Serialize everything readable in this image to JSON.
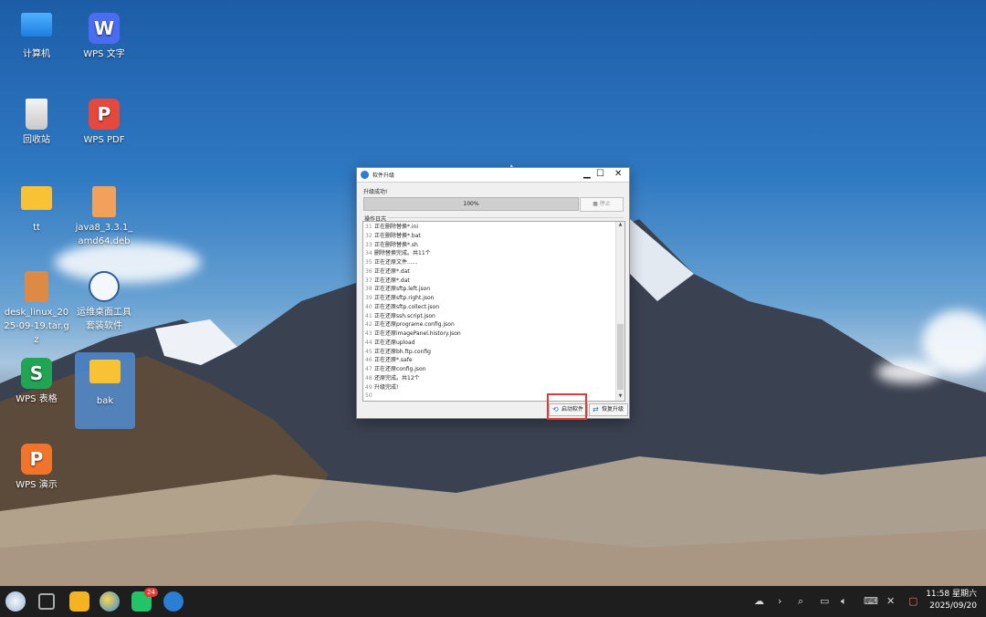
{
  "desktop_icons": [
    {
      "label": "计算机",
      "icon": "computer-icon"
    },
    {
      "label": "WPS 文字",
      "icon": "wps-writer-icon"
    },
    {
      "label": "回收站",
      "icon": "recycle-bin-icon"
    },
    {
      "label": "WPS PDF",
      "icon": "wps-pdf-icon"
    },
    {
      "label": "tt",
      "icon": "folder-icon"
    },
    {
      "label": "java8_3.3.1_amd64.deb",
      "icon": "deb-package-icon"
    },
    {
      "label": "desk_linux_2025-09-19.tar.gz",
      "icon": "archive-icon"
    },
    {
      "label": "运维桌面工具套装软件",
      "icon": "ops-tool-icon"
    },
    {
      "label": "WPS 表格",
      "icon": "wps-sheets-icon"
    },
    {
      "label": "bak",
      "icon": "folder-icon"
    },
    {
      "label": "WPS 演示",
      "icon": "wps-presentation-icon"
    }
  ],
  "dialog": {
    "title": "软件升级",
    "status": "升级成功!",
    "progress_text": "100%",
    "progress_value": 100,
    "stop_label": "停止",
    "log_group_label": "操作日志",
    "log": [
      {
        "n": "31",
        "text": "正在删除替换*.ini"
      },
      {
        "n": "32",
        "text": "正在删除替换*.bat"
      },
      {
        "n": "33",
        "text": "正在删除替换*.sh"
      },
      {
        "n": "34",
        "text": "删除替换完成。共11个"
      },
      {
        "n": "35",
        "text": "正在还原文件......"
      },
      {
        "n": "36",
        "text": "正在还原*.dat"
      },
      {
        "n": "37",
        "text": "正在还原*.dat"
      },
      {
        "n": "38",
        "text": "正在还原sftp.left.json"
      },
      {
        "n": "39",
        "text": "正在还原sftp.right.json"
      },
      {
        "n": "40",
        "text": "正在还原sftp.collect.json"
      },
      {
        "n": "41",
        "text": "正在还原ssh.script.json"
      },
      {
        "n": "42",
        "text": "正在还原programe.config.json"
      },
      {
        "n": "43",
        "text": "正在还原imagePanel.history.json"
      },
      {
        "n": "44",
        "text": "正在还原upload"
      },
      {
        "n": "45",
        "text": "正在还原bh.ftp.config"
      },
      {
        "n": "46",
        "text": "正在还原*.safe"
      },
      {
        "n": "47",
        "text": "正在还原config.json"
      },
      {
        "n": "48",
        "text": "还原完成。共12个"
      },
      {
        "n": "49",
        "text": "升级完成!"
      },
      {
        "n": "50",
        "text": ""
      }
    ],
    "launch_label": "启动软件",
    "restore_label": "恢复升级"
  },
  "taskbar": {
    "badge_count": "24",
    "time": "11:58 星期六",
    "date": "2025/09/20"
  }
}
